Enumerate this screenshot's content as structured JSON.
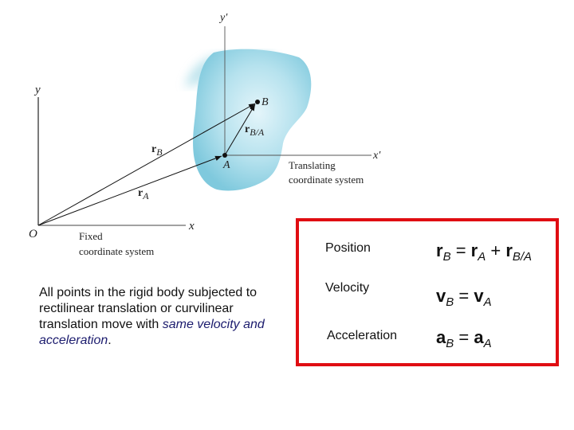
{
  "diagram": {
    "fixed_axes": {
      "y_label": "y",
      "x_label": "x",
      "origin_label": "O"
    },
    "fixed_caption": [
      "Fixed",
      "coordinate system"
    ],
    "translating_axes": {
      "y_label": "y′",
      "x_label": "x′"
    },
    "translating_caption": [
      "Translating",
      "coordinate system"
    ],
    "points": {
      "a": "A",
      "b": "B"
    },
    "vectors": {
      "rB": {
        "main": "r",
        "sub": "B"
      },
      "rA": {
        "main": "r",
        "sub": "A"
      },
      "rBA": {
        "main": "r",
        "sub": "B/A"
      }
    },
    "colors": {
      "body": "#8fd0e0",
      "box_border": "#e00d12",
      "emphasis": "#1c1c6e"
    }
  },
  "description": {
    "plain": "All points in the rigid body subjected to rectilinear translation or curvilinear translation move with ",
    "emphasis1": "same velocity",
    "middle": " ",
    "emphasis2": "and acceleration",
    "end": "."
  },
  "equations": [
    {
      "label": "Position",
      "lhs": "r",
      "lhs_sub": "B",
      "eq": " = ",
      "r1": "r",
      "r1_sub": "A",
      "plus": " + ",
      "r2": "r",
      "r2_sub": "B/A"
    },
    {
      "label": "Velocity",
      "lhs": "v",
      "lhs_sub": "B",
      "eq": " = ",
      "r1": "v",
      "r1_sub": "A"
    },
    {
      "label": "Acceleration",
      "lhs": "a",
      "lhs_sub": "B",
      "eq": " = ",
      "r1": "a",
      "r1_sub": "A"
    }
  ]
}
